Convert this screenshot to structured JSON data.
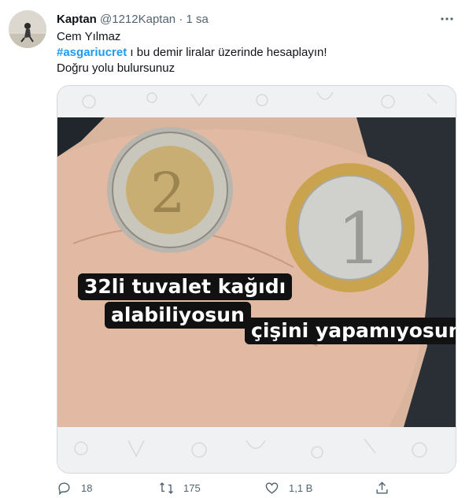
{
  "tweet": {
    "author_name": "Kaptan",
    "author_handle": "@1212Kaptan",
    "separator": "·",
    "time": "1 sa",
    "text_line1": "Cem Yılmaz",
    "hashtag": "#asgariucret",
    "text_line2_rest": " ı bu demir liralar üzerinde hesaplayın!",
    "text_line3": "Doğru yolu bulursunuz"
  },
  "media": {
    "caption_line1": "32li tuvalet kağıdı",
    "caption_line2": "alabiliyosun",
    "caption_line3": "çişini yapamıyosun"
  },
  "actions": {
    "reply_count": "18",
    "retweet_count": "175",
    "like_count": "1,1 B"
  },
  "colors": {
    "accent": "#1d9bf0",
    "secondary_text": "#536471",
    "border": "#cfd9de"
  }
}
